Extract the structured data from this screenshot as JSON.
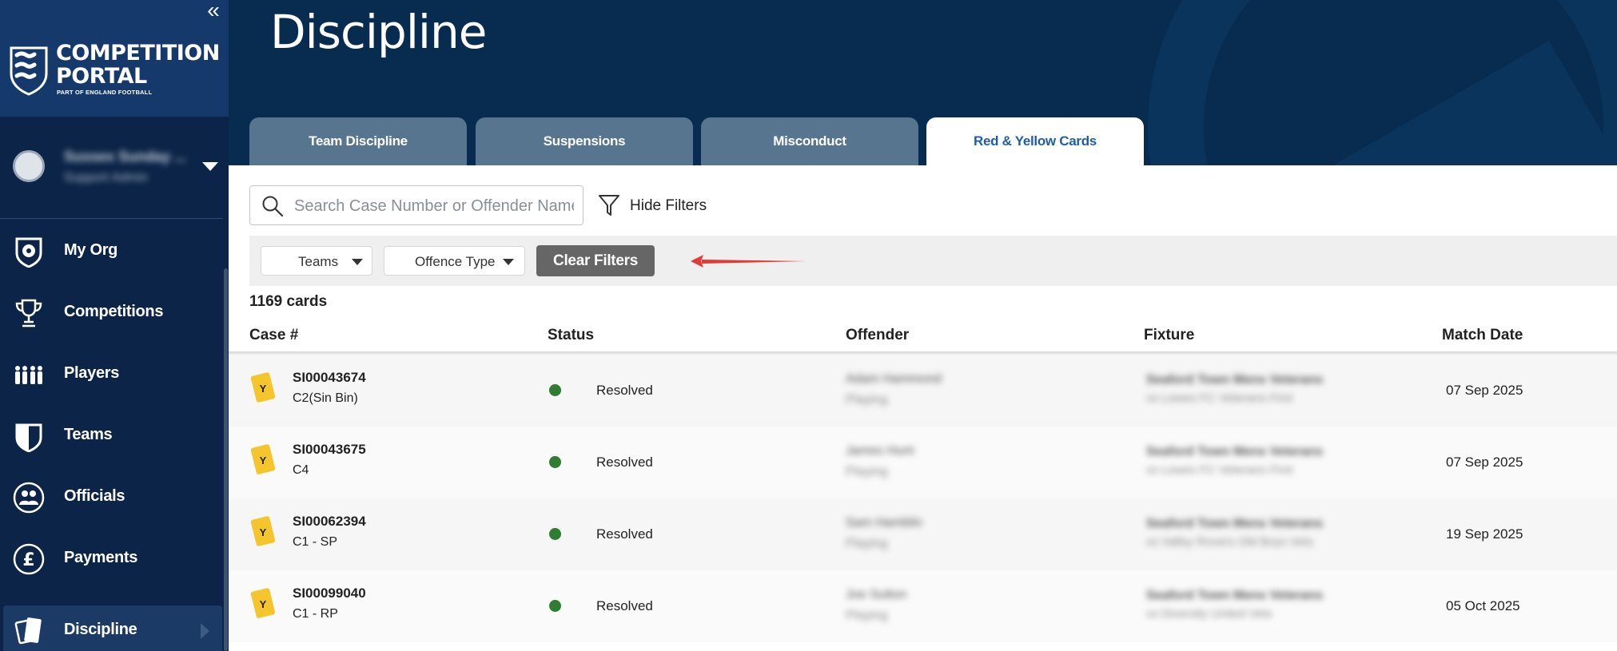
{
  "brand": {
    "title_line1": "COMPETITION",
    "title_line2": "PORTAL",
    "subtitle": "PART OF ENGLAND FOOTBALL",
    "collapse_symbol": "«"
  },
  "user": {
    "name": "Sussex Sunday ...",
    "role": "Support Admin"
  },
  "sidebar": {
    "items": [
      {
        "label": "My Org",
        "icon": "shield-ball-icon"
      },
      {
        "label": "Competitions",
        "icon": "trophy-icon"
      },
      {
        "label": "Players",
        "icon": "players-group-icon"
      },
      {
        "label": "Teams",
        "icon": "team-shield-icon"
      },
      {
        "label": "Officials",
        "icon": "officials-icon"
      },
      {
        "label": "Payments",
        "icon": "pound-icon"
      },
      {
        "label": "Discipline",
        "icon": "cards-icon",
        "active": true
      }
    ]
  },
  "page": {
    "title": "Discipline"
  },
  "tabs": [
    {
      "label": "Team Discipline"
    },
    {
      "label": "Suspensions"
    },
    {
      "label": "Misconduct"
    },
    {
      "label": "Red & Yellow Cards",
      "active": true
    }
  ],
  "search": {
    "placeholder": "Search Case Number or Offender Name",
    "value": ""
  },
  "filters": {
    "hide_label": "Hide Filters",
    "teams_label": "Teams",
    "offence_label": "Offence Type",
    "clear_label": "Clear Filters"
  },
  "results": {
    "count_text": "1169 cards"
  },
  "table": {
    "columns": [
      "Case #",
      "Status",
      "Offender",
      "Fixture",
      "Match Date"
    ],
    "rows": [
      {
        "card": "Y",
        "case_no": "SI00043674",
        "offence": "C2(Sin Bin)",
        "status": "Resolved",
        "offender": "Adam Hammond",
        "offender_role": "Playing",
        "fixture": "Seaford Town Mens Veterans",
        "fixture_sub": "vs Lewes FC Veterans First",
        "date": "07 Sep 2025"
      },
      {
        "card": "Y",
        "case_no": "SI00043675",
        "offence": "C4",
        "status": "Resolved",
        "offender": "James Hunt",
        "offender_role": "Playing",
        "fixture": "Seaford Town Mens Veterans",
        "fixture_sub": "vs Lewes FC Veterans First",
        "date": "07 Sep 2025"
      },
      {
        "card": "Y",
        "case_no": "SI00062394",
        "offence": "C1 - SP",
        "status": "Resolved",
        "offender": "Sam Hamblin",
        "offender_role": "Playing",
        "fixture": "Seaford Town Mens Veterans",
        "fixture_sub": "vs Valley Rovers Old Boys Vets",
        "date": "19 Sep 2025"
      },
      {
        "card": "Y",
        "case_no": "SI00099040",
        "offence": "C1 - RP",
        "status": "Resolved",
        "offender": "Joe Sutton",
        "offender_role": "Playing",
        "fixture": "Seaford Town Mens Veterans",
        "fixture_sub": "vs Diversity United Vets",
        "date": "05 Oct 2025"
      }
    ]
  },
  "colors": {
    "sidebar_bg": "#0b2447",
    "header_bg": "#072c50",
    "tab_bg": "#587590",
    "active_tab_text": "#1f5ea7",
    "status_resolved": "#2e7d32",
    "yellow_card": "#f5c52e",
    "annotation_arrow": "#e53935"
  }
}
